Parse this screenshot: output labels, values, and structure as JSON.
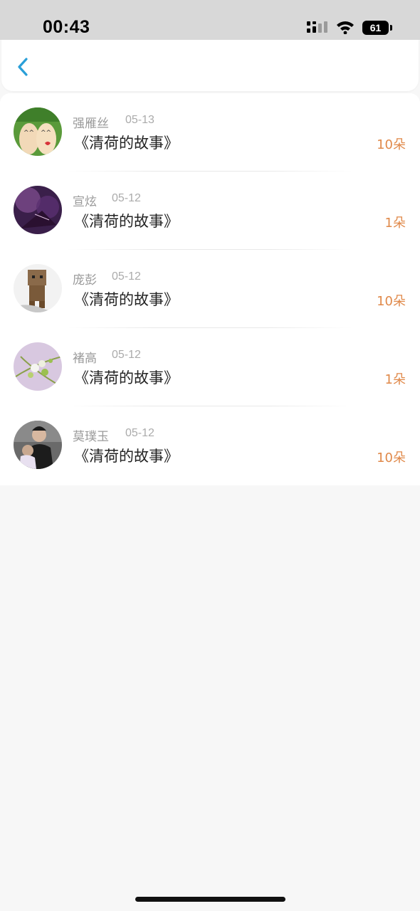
{
  "status_bar": {
    "time": "00:43",
    "battery": "61"
  },
  "nav": {
    "back_icon": "chevron-left-icon",
    "accent_color": "#2a9fd8"
  },
  "gifts": [
    {
      "name": "强雁丝",
      "date": "05-13",
      "title": "《清荷的故事》",
      "count": "10朵"
    },
    {
      "name": "宣炫",
      "date": "05-12",
      "title": "《清荷的故事》",
      "count": "1朵"
    },
    {
      "name": "庞彭",
      "date": "05-12",
      "title": "《清荷的故事》",
      "count": "10朵"
    },
    {
      "name": "褚高",
      "date": "05-12",
      "title": "《清荷的故事》",
      "count": "1朵"
    },
    {
      "name": "莫璞玉",
      "date": "05-12",
      "title": "《清荷的故事》",
      "count": "10朵"
    }
  ],
  "colors": {
    "count": "#e0894a",
    "name": "#9a9a9a"
  }
}
